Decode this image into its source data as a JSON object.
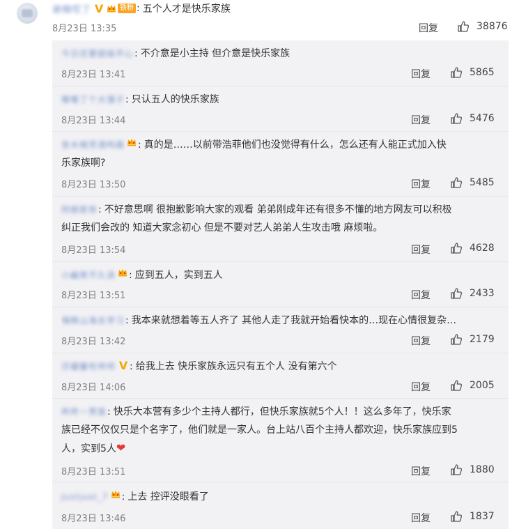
{
  "main_comment": {
    "user": "谢楠哎了",
    "fan_tag": "铁粉",
    "text": "五个人才是快乐家族",
    "time": "8月23日 13:35",
    "reply_label": "回复",
    "likes": "38876"
  },
  "replies": [
    {
      "user": "今日还要超级开心",
      "badge": "none",
      "text": "不介意是小主持 但介意是快乐家族",
      "time": "8月23日 13:41",
      "reply_label": "回复",
      "likes": "5865"
    },
    {
      "user": "嘟嘟了个大馒子",
      "badge": "none",
      "text": "只认五人的快乐家族",
      "time": "8月23日 13:44",
      "reply_label": "回复",
      "likes": "5476"
    },
    {
      "user": "杏木楠芳酒鸣路",
      "badge": "crown",
      "text": "真的是……以前带浩菲他们也没觉得有什么，怎么还有人能正式加入快乐家族啊?",
      "line1": "真的是……以前带浩菲他们也没觉得有什么，怎么还有人能正式加入快",
      "line2": "乐家族啊?",
      "time": "8月23日 13:50",
      "reply_label": "回复",
      "likes": "5485"
    },
    {
      "user": "阿娘耶背",
      "badge": "none",
      "line1": "不好意思啊 很抱歉影响大家的观看 弟弟刚成年还有很多不懂的地方网友可以积极",
      "line2": "纠正我们会改的 知道大家念初心 但是不要对艺人弟弟人生攻击哦 麻烦啦。",
      "time": "8月23日 13:54",
      "reply_label": "回复",
      "likes": "4628"
    },
    {
      "user": "小鹹男不久浪",
      "badge": "crown",
      "text": "应到五人，实到五人",
      "time": "8月23日 13:51",
      "reply_label": "回复",
      "likes": "2433"
    },
    {
      "user": "嗨眯山海去学习",
      "badge": "none",
      "text": "我本来就想着等五人齐了 其他人走了我就开始看快本的…现在心情很复杂…",
      "time": "8月23日 13:42",
      "reply_label": "回复",
      "likes": "2179"
    },
    {
      "user": "莎罐馨吃咩咩",
      "badge": "v",
      "text": "给我上去 快乐家族永远只有五个人 没有第六个",
      "time": "8月23日 14:06",
      "reply_label": "回复",
      "likes": "2005"
    },
    {
      "user": "咚咚一贯我",
      "badge": "none",
      "line1": "快乐大本营有多少个主持人都行，但快乐家族就5个人！！这么多年了，快乐家",
      "line2": "族已经不仅仅只是个名字了，他们就是一家人。台上站八百个主持人都欢迎，快乐家族应到5",
      "line3": "人，实到5人",
      "time": "8月23日 13:51",
      "reply_label": "回复",
      "likes": "1880"
    },
    {
      "user": "Justjust_7",
      "badge": "crown",
      "text": "上去 控评没眼看了",
      "time": "8月23日 13:46",
      "reply_label": "回复",
      "likes": "1837"
    }
  ],
  "colors": {
    "link_blue": "#4a6fb5",
    "fan_orange": "#f7a627",
    "heart_red": "#e53935",
    "reply_bg": "#f2f2f5"
  }
}
